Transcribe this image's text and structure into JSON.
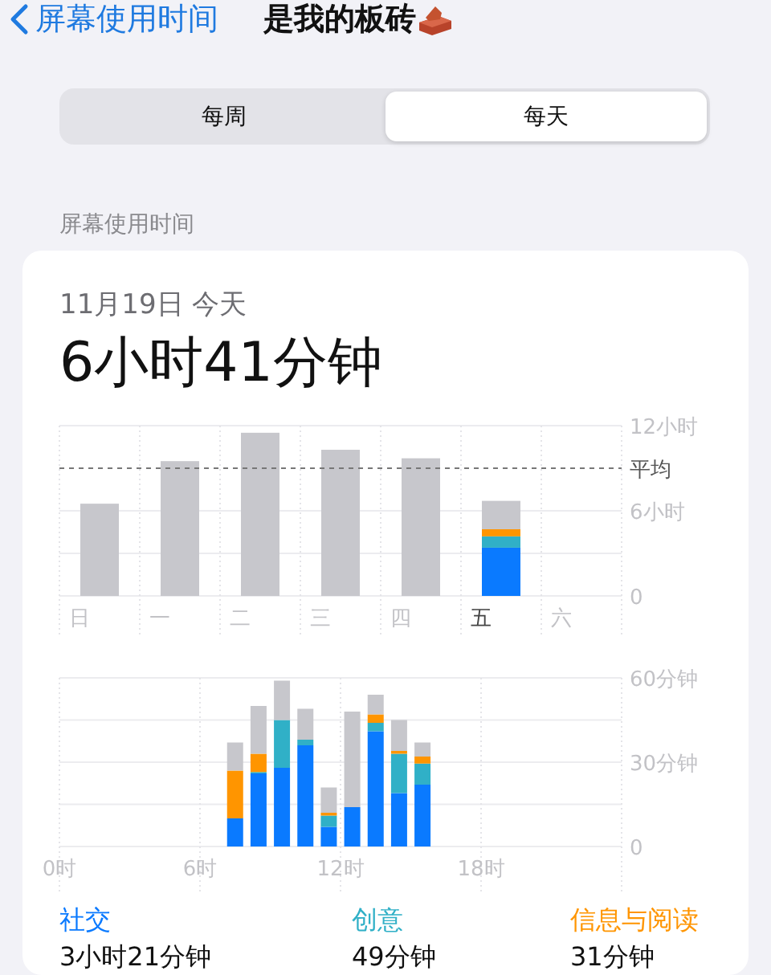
{
  "nav": {
    "back_label": "屏幕使用时间",
    "title": "是我的板砖"
  },
  "segments": [
    {
      "label": "每周",
      "selected": false
    },
    {
      "label": "每天",
      "selected": true
    }
  ],
  "section_title": "屏幕使用时间",
  "summary": {
    "date": "11月19日 今天",
    "total": "6小时41分钟",
    "daily_chart": {
      "selected_days": [
        false,
        false,
        false,
        false,
        false,
        true,
        false
      ],
      "chart_data": {
        "type": "bar",
        "stacked": true,
        "categories": [
          "日",
          "一",
          "二",
          "三",
          "四",
          "五",
          "六"
        ],
        "series": [
          {
            "color": "#0a7aff",
            "values": [
              0,
              0,
              0,
              0,
              0,
              3.4,
              null
            ]
          },
          {
            "color": "#30b0c7",
            "values": [
              0,
              0,
              0,
              0,
              0,
              0.8,
              null
            ]
          },
          {
            "color": "#ff9500",
            "values": [
              0,
              0,
              0,
              0,
              0,
              0.5,
              null
            ]
          },
          {
            "color": "#c7c7cc",
            "values": [
              6.5,
              9.5,
              11.5,
              10.3,
              9.7,
              2.0,
              null
            ]
          }
        ],
        "ylim": [
          0,
          12
        ],
        "yticks": [
          {
            "value": 0,
            "label": "0"
          },
          {
            "value": 6,
            "label": "6小时"
          },
          {
            "value": 12,
            "label": "12小时"
          }
        ],
        "grid": true,
        "ref_lines": [
          {
            "axis": "y",
            "value": 9,
            "label": "平均"
          }
        ]
      }
    },
    "hourly_chart": {
      "chart_data": {
        "type": "bar",
        "stacked": true,
        "x": [
          7.5,
          8.5,
          9.5,
          10.5,
          11.5,
          12.5,
          13.5,
          14.5,
          15.5
        ],
        "series": [
          {
            "color": "#0a7aff",
            "values": [
              10,
              26,
              28,
              36,
              7,
              14,
              41,
              19,
              22
            ]
          },
          {
            "color": "#30b0c7",
            "values": [
              0,
              0.5,
              17,
              2,
              4,
              0,
              3,
              14,
              7.5
            ]
          },
          {
            "color": "#ff9500",
            "values": [
              17,
              6.5,
              0,
              0,
              1,
              0,
              3,
              1,
              2.5
            ]
          },
          {
            "color": "#c7c7cc",
            "values": [
              10,
              17,
              14,
              11,
              9,
              34,
              7,
              11,
              5
            ]
          }
        ],
        "grid": true,
        "xlim": [
          0,
          24
        ],
        "xticks": [
          {
            "value": 0,
            "label": "0时"
          },
          {
            "value": 6,
            "label": "6时"
          },
          {
            "value": 12,
            "label": "12时"
          },
          {
            "value": 18,
            "label": "18时"
          }
        ],
        "ylim": [
          0,
          60
        ],
        "yticks": [
          {
            "value": 0,
            "label": "0"
          },
          {
            "value": 30,
            "label": "30分钟"
          },
          {
            "value": 60,
            "label": "60分钟"
          }
        ]
      }
    },
    "legend": [
      {
        "label": "社交",
        "value": "3小时21分钟",
        "color": "#0a7aff"
      },
      {
        "label": "创意",
        "value": "49分钟",
        "color": "#30b0c7"
      },
      {
        "label": "信息与阅读",
        "value": "31分钟",
        "color": "#ff9500"
      }
    ]
  }
}
